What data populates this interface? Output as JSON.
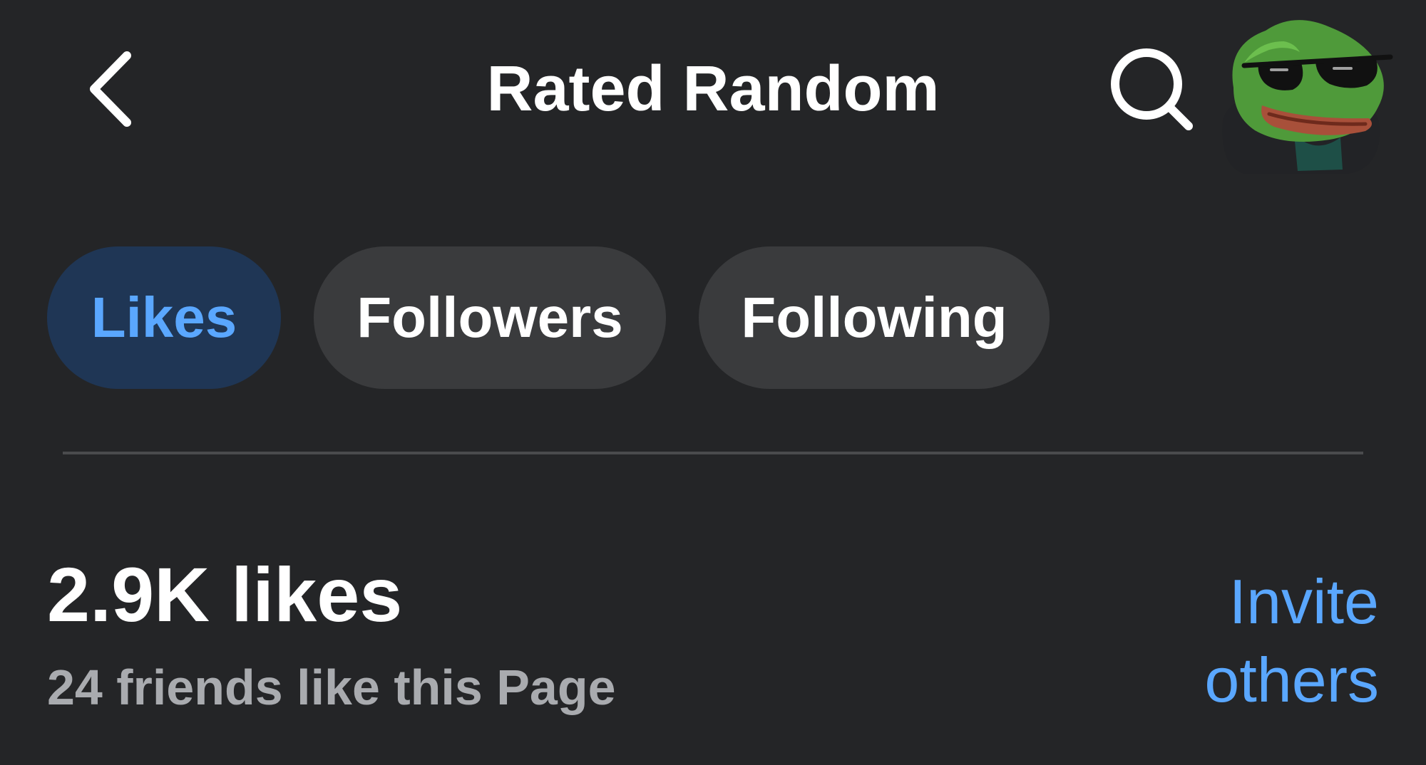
{
  "header": {
    "title": "Rated Random",
    "back_icon": "chevron-left-icon",
    "search_icon": "search-icon",
    "avatar_icon": "frog-avatar"
  },
  "tabs": [
    {
      "label": "Likes",
      "active": true
    },
    {
      "label": "Followers",
      "active": false
    },
    {
      "label": "Following",
      "active": false
    }
  ],
  "summary": {
    "count": "2.9K likes",
    "friends": "24 friends like this Page",
    "invite_line1": "Invite",
    "invite_line2": "others"
  },
  "colors": {
    "background": "#242527",
    "accent": "#5aa7ff",
    "active_tab_bg": "#1f3655",
    "tab_bg": "#3a3b3d",
    "muted_text": "#a9abaf"
  }
}
